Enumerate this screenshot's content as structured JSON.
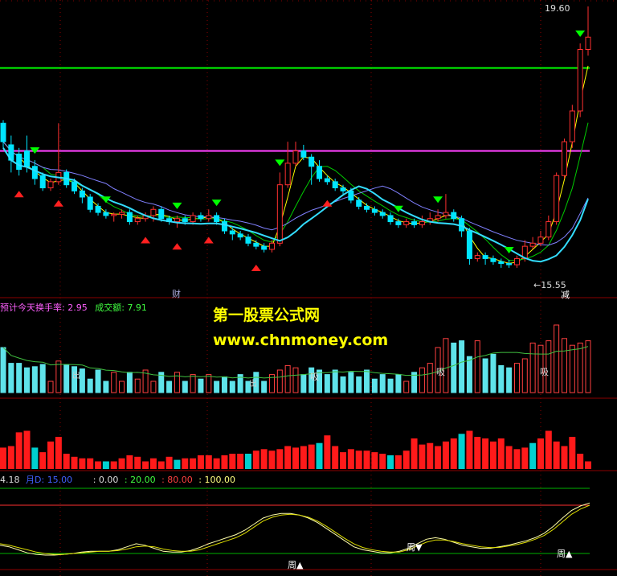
{
  "watermark": {
    "line1": "第一股票公式网",
    "line2": "www.chnmoney.com"
  },
  "main_panel": {
    "high_label": "19.60",
    "low_label": "←15.55",
    "event_labels": [
      "财",
      "减"
    ],
    "colors": {
      "up": "#ff3030",
      "down": "#00e5ff",
      "green_line": "#00ff00",
      "magenta_line": "#ff40ff",
      "ma_fast": "#ffff00",
      "ma_mid": "#00cc00",
      "ma_slow": "#8080ff",
      "curve": "#33ddff"
    }
  },
  "volume_panel": {
    "header_prefix": "预计今天换手率:",
    "turnover": "2.95",
    "amount_label": "成交额:",
    "amount": "7.91",
    "markers": [
      "出",
      "吸",
      "吸",
      "吸",
      "出"
    ]
  },
  "oscillator_panel": {
    "header_left": "4.18",
    "header_name": "月D:",
    "header_name_val": "15.00",
    "levels": [
      ": 0.00",
      ": 20.00",
      ": 80.00",
      ": 100.00"
    ],
    "markers": [
      "周▲",
      "周▼",
      "周▲"
    ]
  },
  "chart_data": {
    "type": "candlestick",
    "price_range": [
      15.3,
      19.8
    ],
    "reference_levels": {
      "green": 18.8,
      "magenta": 17.45
    },
    "high_marker": 19.6,
    "low_marker": 15.55,
    "candles": [
      [
        17.9,
        17.6,
        17.95,
        17.5
      ],
      [
        17.55,
        17.3,
        17.7,
        17.1
      ],
      [
        17.4,
        17.15,
        17.5,
        17.05
      ],
      [
        17.45,
        17.2,
        17.7,
        17.1
      ],
      [
        17.2,
        17.0,
        17.3,
        16.9
      ],
      [
        17.05,
        16.85,
        17.1,
        16.8
      ],
      [
        16.85,
        16.95,
        17.0,
        16.8
      ],
      [
        16.95,
        17.1,
        17.9,
        16.9
      ],
      [
        17.1,
        16.9,
        17.15,
        16.85
      ],
      [
        16.95,
        16.8,
        17.0,
        16.75
      ],
      [
        16.8,
        16.7,
        16.85,
        16.6
      ],
      [
        16.7,
        16.5,
        16.75,
        16.45
      ],
      [
        16.55,
        16.45,
        16.6,
        16.4
      ],
      [
        16.45,
        16.4,
        16.5,
        16.35
      ],
      [
        16.4,
        16.42,
        16.45,
        16.3
      ],
      [
        16.42,
        16.45,
        16.5,
        16.35
      ],
      [
        16.45,
        16.3,
        16.5,
        16.25
      ],
      [
        16.3,
        16.35,
        16.4,
        16.25
      ],
      [
        16.35,
        16.4,
        16.45,
        16.3
      ],
      [
        16.4,
        16.5,
        16.55,
        16.3
      ],
      [
        16.5,
        16.35,
        16.55,
        16.3
      ],
      [
        16.35,
        16.3,
        16.4,
        16.25
      ],
      [
        16.3,
        16.35,
        16.4,
        16.2
      ],
      [
        16.35,
        16.3,
        16.4,
        16.25
      ],
      [
        16.3,
        16.4,
        16.45,
        16.25
      ],
      [
        16.4,
        16.35,
        16.45,
        16.3
      ],
      [
        16.35,
        16.4,
        16.5,
        16.3
      ],
      [
        16.4,
        16.3,
        16.45,
        16.25
      ],
      [
        16.3,
        16.15,
        16.35,
        16.1
      ],
      [
        16.15,
        16.1,
        16.2,
        16.0
      ],
      [
        16.1,
        16.05,
        16.15,
        16.0
      ],
      [
        16.05,
        15.95,
        16.1,
        15.9
      ],
      [
        15.95,
        15.9,
        16.0,
        15.85
      ],
      [
        15.9,
        15.85,
        15.95,
        15.8
      ],
      [
        15.85,
        15.95,
        16.0,
        15.8
      ],
      [
        15.95,
        16.9,
        17.1,
        15.9
      ],
      [
        16.9,
        17.25,
        17.6,
        16.85
      ],
      [
        17.25,
        17.45,
        17.6,
        17.2
      ],
      [
        17.45,
        17.35,
        17.55,
        17.3
      ],
      [
        17.35,
        17.2,
        17.4,
        16.9
      ],
      [
        17.2,
        17.0,
        17.3,
        16.95
      ],
      [
        17.0,
        16.95,
        17.05,
        16.9
      ],
      [
        16.95,
        16.85,
        17.0,
        16.8
      ],
      [
        16.85,
        16.8,
        16.9,
        16.75
      ],
      [
        16.8,
        16.65,
        16.85,
        16.6
      ],
      [
        16.65,
        16.55,
        16.7,
        16.5
      ],
      [
        16.55,
        16.5,
        16.6,
        16.45
      ],
      [
        16.5,
        16.45,
        16.55,
        16.4
      ],
      [
        16.45,
        16.4,
        16.5,
        16.35
      ],
      [
        16.4,
        16.3,
        16.45,
        16.25
      ],
      [
        16.3,
        16.25,
        16.35,
        16.2
      ],
      [
        16.25,
        16.3,
        16.35,
        16.2
      ],
      [
        16.3,
        16.25,
        16.35,
        16.2
      ],
      [
        16.25,
        16.3,
        16.4,
        16.2
      ],
      [
        16.3,
        16.35,
        16.45,
        16.25
      ],
      [
        16.35,
        16.4,
        16.5,
        16.3
      ],
      [
        16.4,
        16.45,
        16.75,
        16.35
      ],
      [
        16.45,
        16.35,
        16.5,
        16.3
      ],
      [
        16.35,
        16.15,
        16.4,
        16.05
      ],
      [
        16.15,
        15.7,
        16.2,
        15.6
      ],
      [
        15.7,
        15.75,
        15.8,
        15.65
      ],
      [
        15.75,
        15.7,
        15.8,
        15.6
      ],
      [
        15.7,
        15.65,
        15.75,
        15.6
      ],
      [
        15.65,
        15.62,
        15.7,
        15.55
      ],
      [
        15.62,
        15.6,
        15.68,
        15.55
      ],
      [
        15.6,
        15.7,
        15.75,
        15.55
      ],
      [
        15.7,
        15.9,
        16.0,
        15.65
      ],
      [
        15.9,
        15.95,
        16.05,
        15.85
      ],
      [
        15.95,
        16.05,
        16.15,
        15.9
      ],
      [
        16.05,
        16.3,
        16.4,
        16.0
      ],
      [
        16.3,
        17.05,
        17.1,
        16.25
      ],
      [
        17.05,
        17.6,
        17.65,
        17.0
      ],
      [
        17.6,
        18.1,
        18.2,
        17.5
      ],
      [
        18.1,
        19.1,
        19.2,
        18.0
      ],
      [
        19.1,
        19.3,
        19.8,
        19.0
      ]
    ],
    "volumes": [
      40,
      26,
      26,
      22,
      23,
      25,
      10,
      28,
      25,
      23,
      21,
      12,
      20,
      10,
      18,
      10,
      18,
      12,
      20,
      10,
      18,
      10,
      18,
      10,
      16,
      12,
      16,
      10,
      14,
      10,
      16,
      10,
      18,
      10,
      16,
      20,
      24,
      22,
      16,
      22,
      20,
      16,
      20,
      14,
      18,
      14,
      20,
      12,
      16,
      12,
      16,
      10,
      18,
      22,
      26,
      40,
      48,
      44,
      46,
      32,
      46,
      30,
      34,
      24,
      22,
      26,
      30,
      44,
      42,
      46,
      60,
      48,
      42,
      44,
      46
    ],
    "volumes2": [
      28,
      30,
      48,
      50,
      28,
      22,
      36,
      42,
      20,
      16,
      14,
      14,
      10,
      10,
      10,
      14,
      18,
      16,
      10,
      14,
      10,
      16,
      12,
      14,
      14,
      18,
      18,
      14,
      18,
      20,
      20,
      20,
      24,
      26,
      24,
      26,
      30,
      28,
      30,
      32,
      34,
      44,
      30,
      22,
      26,
      24,
      24,
      22,
      20,
      18,
      18,
      24,
      40,
      32,
      34,
      30,
      36,
      40,
      46,
      50,
      42,
      40,
      36,
      40,
      30,
      26,
      28,
      34,
      40,
      50,
      36,
      30,
      42,
      20,
      10
    ],
    "osc_k": [
      30,
      28,
      24,
      20,
      18,
      17,
      17,
      18,
      19,
      21,
      22,
      22,
      22,
      24,
      28,
      32,
      30,
      26,
      22,
      21,
      21,
      23,
      27,
      32,
      36,
      40,
      44,
      50,
      58,
      66,
      70,
      72,
      72,
      70,
      66,
      60,
      52,
      44,
      36,
      28,
      24,
      22,
      20,
      20,
      22,
      26,
      32,
      38,
      40,
      38,
      34,
      30,
      28,
      26,
      26,
      28,
      30,
      33,
      36,
      40,
      46,
      55,
      66,
      76,
      82,
      86
    ],
    "osc_d": [
      32,
      30,
      27,
      24,
      21,
      19,
      18,
      18,
      19,
      20,
      21,
      22,
      22,
      23,
      25,
      28,
      29,
      28,
      25,
      23,
      22,
      22,
      24,
      28,
      32,
      36,
      40,
      46,
      54,
      62,
      67,
      70,
      71,
      70,
      67,
      62,
      55,
      47,
      39,
      32,
      27,
      24,
      22,
      21,
      21,
      24,
      29,
      34,
      37,
      37,
      35,
      32,
      30,
      28,
      27,
      27,
      29,
      31,
      34,
      38,
      43,
      51,
      61,
      71,
      78,
      83
    ]
  }
}
